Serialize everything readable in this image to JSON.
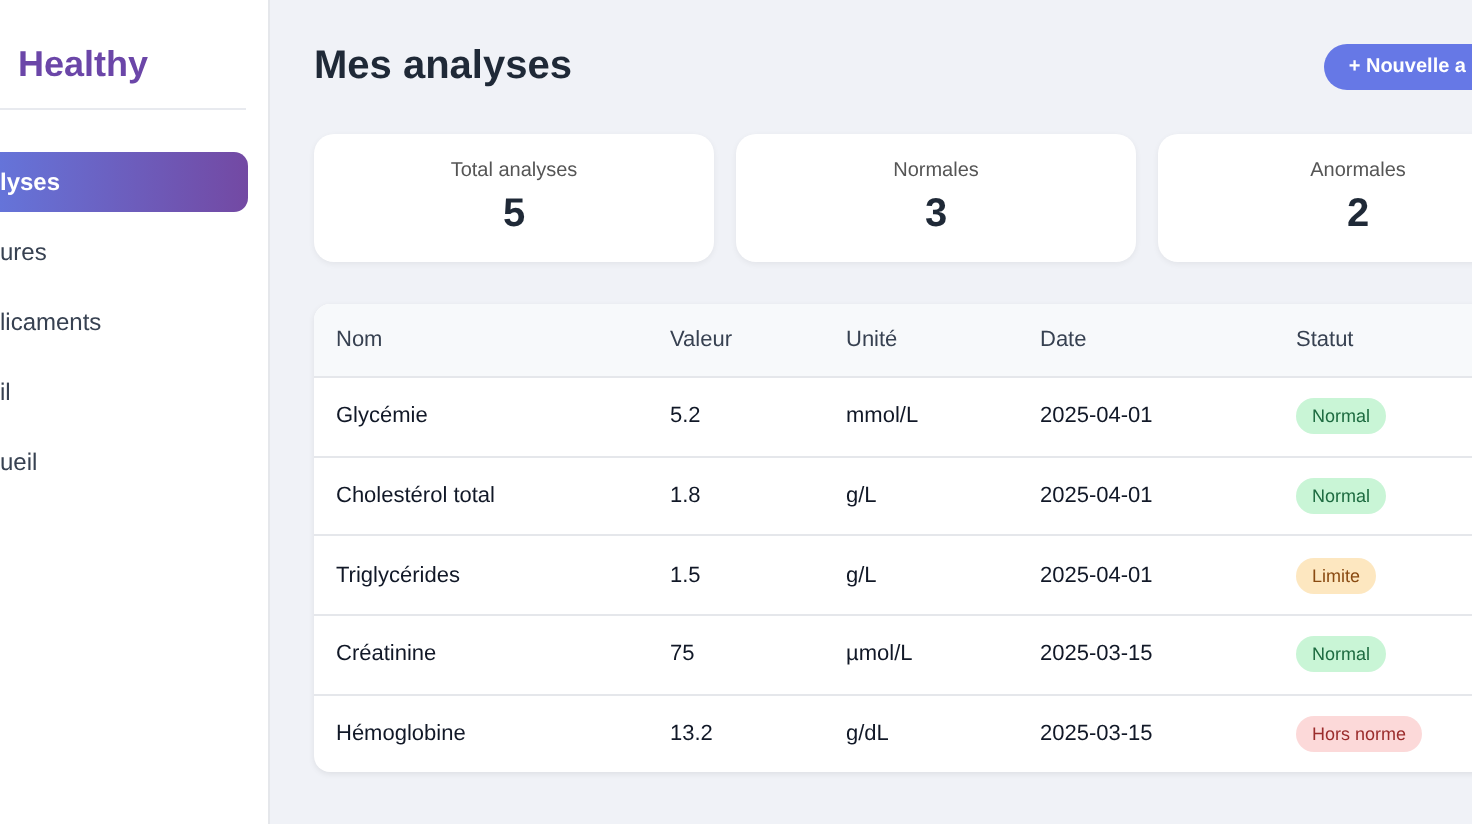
{
  "sidebar": {
    "brand": "Healthy",
    "items": [
      {
        "label": "lyses",
        "selected": true
      },
      {
        "label": "ures",
        "selected": false
      },
      {
        "label": "licaments",
        "selected": false
      },
      {
        "label": "il",
        "selected": false
      },
      {
        "label": "ueil",
        "selected": false
      }
    ]
  },
  "header": {
    "title": "Mes analyses",
    "button": "+ Nouvelle a"
  },
  "stats": [
    {
      "label": "Total analyses",
      "value": "5"
    },
    {
      "label": "Normales",
      "value": "3"
    },
    {
      "label": "Anormales",
      "value": "2"
    }
  ],
  "table": {
    "columns": [
      "Nom",
      "Valeur",
      "Unité",
      "Date",
      "Statut"
    ],
    "rows": [
      {
        "name": "Glycémie",
        "value": "5.2",
        "unit": "mmol/L",
        "date": "2025-04-01",
        "status": "Normal",
        "kind": "normal"
      },
      {
        "name": "Cholestérol total",
        "value": "1.8",
        "unit": "g/L",
        "date": "2025-04-01",
        "status": "Normal",
        "kind": "normal"
      },
      {
        "name": "Triglycérides",
        "value": "1.5",
        "unit": "g/L",
        "date": "2025-04-01",
        "status": "Limite",
        "kind": "limit"
      },
      {
        "name": "Créatinine",
        "value": "75",
        "unit": "µmol/L",
        "date": "2025-03-15",
        "status": "Normal",
        "kind": "normal"
      },
      {
        "name": "Hémoglobine",
        "value": "13.2",
        "unit": "g/dL",
        "date": "2025-03-15",
        "status": "Hors norme",
        "kind": "abnormal"
      }
    ]
  }
}
